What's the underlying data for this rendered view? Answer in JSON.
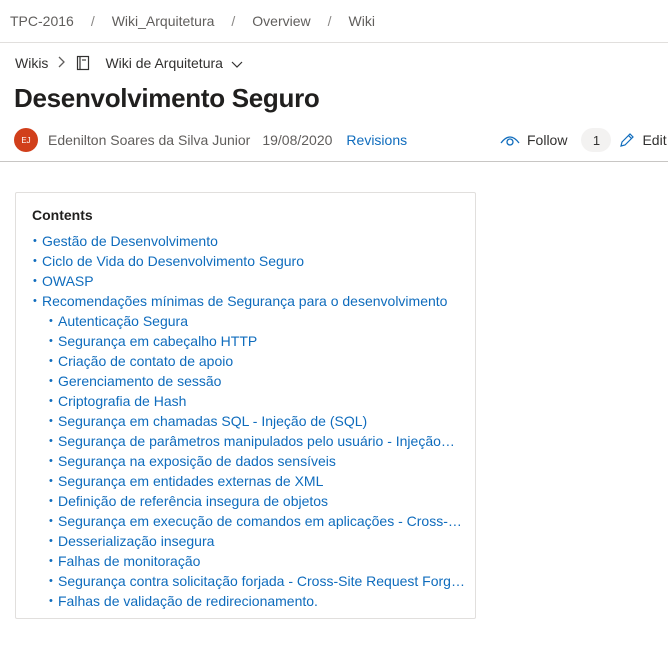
{
  "breadcrumb": {
    "items": [
      "TPC-2016",
      "Wiki_Arquitetura",
      "Overview",
      "Wiki"
    ],
    "separator": "/"
  },
  "wikinav": {
    "root": "Wikis",
    "wiki_name": "Wiki de Arquitetura"
  },
  "page": {
    "title": "Desenvolvimento Seguro"
  },
  "meta": {
    "avatar_initials": "EJ",
    "author": "Edenilton Soares da Silva Junior",
    "date": "19/08/2020",
    "revisions": "Revisions",
    "follow": "Follow",
    "follow_count": "1",
    "edit": "Edit p"
  },
  "toc": {
    "heading": "Contents",
    "items": [
      {
        "label": "Gestão de Desenvolvimento",
        "level": 1
      },
      {
        "label": "Ciclo de Vida do Desenvolvimento Seguro",
        "level": 1
      },
      {
        "label": "OWASP",
        "level": 1
      },
      {
        "label": "Recomendações mínimas de Segurança para o desenvolvimento",
        "level": 1
      },
      {
        "label": "Autenticação Segura",
        "level": 2
      },
      {
        "label": "Segurança em cabeçalho HTTP",
        "level": 2
      },
      {
        "label": "Criação de contato de apoio",
        "level": 2
      },
      {
        "label": "Gerenciamento de sessão",
        "level": 2
      },
      {
        "label": "Criptografia de Hash",
        "level": 2
      },
      {
        "label": "Segurança em chamadas SQL - Injeção de (SQL)",
        "level": 2
      },
      {
        "label": "Segurança de parâmetros manipulados pelo usuário - Injeção…",
        "level": 2
      },
      {
        "label": "Segurança na exposição de dados sensíveis",
        "level": 2
      },
      {
        "label": "Segurança em entidades externas de XML",
        "level": 2
      },
      {
        "label": "Definição de referência insegura de objetos",
        "level": 2
      },
      {
        "label": "Segurança em execução de comandos em aplicações - Cross-S…",
        "level": 2
      },
      {
        "label": "Desserialização insegura",
        "level": 2
      },
      {
        "label": "Falhas de monitoração",
        "level": 2
      },
      {
        "label": "Segurança contra solicitação forjada - Cross-Site Request Forg…",
        "level": 2
      },
      {
        "label": "Falhas de validação de redirecionamento.",
        "level": 2
      }
    ]
  },
  "colors": {
    "link": "#0f6cbd",
    "avatar": "#d13f1b",
    "text": "#323130"
  }
}
